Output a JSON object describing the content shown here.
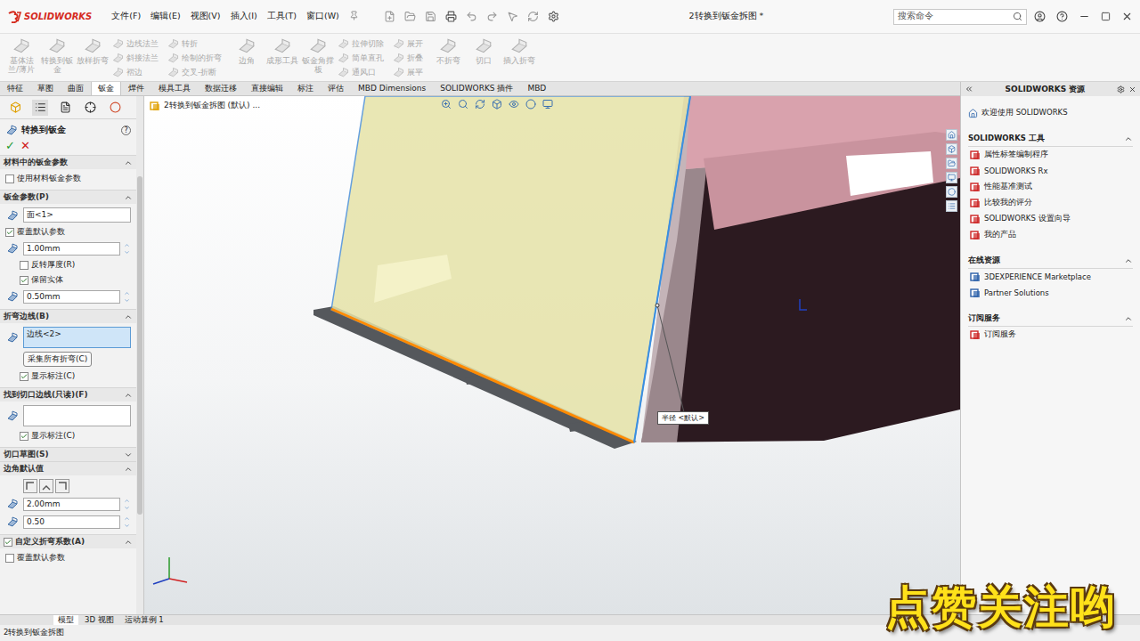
{
  "window": {
    "app": "SOLIDWORKS",
    "title": "2转换到钣金拆图 *"
  },
  "menus": [
    "文件(F)",
    "编辑(E)",
    "视图(V)",
    "插入(I)",
    "工具(T)",
    "窗口(W)"
  ],
  "search": {
    "placeholder": "搜索命令"
  },
  "ribbon": [
    {
      "kind": "large",
      "label": "基体法兰/薄片",
      "disabled": true
    },
    {
      "kind": "large",
      "label": "转换到钣金",
      "disabled": true
    },
    {
      "kind": "large",
      "label": "放样折弯",
      "disabled": true
    },
    {
      "kind": "stack",
      "items": [
        {
          "label": "边线法兰",
          "disabled": true
        },
        {
          "label": "斜接法兰",
          "disabled": true
        },
        {
          "label": "褶边",
          "disabled": true
        }
      ]
    },
    {
      "kind": "stack",
      "items": [
        {
          "label": "转折",
          "disabled": true
        },
        {
          "label": "绘制的折弯",
          "disabled": true
        },
        {
          "label": "交叉-折断",
          "disabled": true
        }
      ]
    },
    {
      "kind": "large",
      "label": "边角",
      "disabled": true
    },
    {
      "kind": "large",
      "label": "成形工具",
      "disabled": true
    },
    {
      "kind": "large",
      "label": "钣金角撑板",
      "disabled": true
    },
    {
      "kind": "stack",
      "items": [
        {
          "label": "拉伸切除",
          "disabled": true
        },
        {
          "label": "简单直孔",
          "disabled": true
        },
        {
          "label": "通风口",
          "disabled": true
        }
      ]
    },
    {
      "kind": "stack",
      "items": [
        {
          "label": "展开",
          "disabled": true
        },
        {
          "label": "折叠",
          "disabled": true
        },
        {
          "label": "展平",
          "disabled": true
        }
      ]
    },
    {
      "kind": "large",
      "label": "不折弯",
      "disabled": true
    },
    {
      "kind": "large",
      "label": "切口",
      "disabled": true
    },
    {
      "kind": "large",
      "label": "插入折弯",
      "disabled": true
    }
  ],
  "tabs": [
    {
      "label": "特征",
      "selected": false
    },
    {
      "label": "草图",
      "selected": false
    },
    {
      "label": "曲面",
      "selected": false
    },
    {
      "label": "钣金",
      "selected": true
    },
    {
      "label": "焊件",
      "selected": false
    },
    {
      "label": "模具工具",
      "selected": false
    },
    {
      "label": "数据迁移",
      "selected": false
    },
    {
      "label": "直接编辑",
      "selected": false
    },
    {
      "label": "标注",
      "selected": false
    },
    {
      "label": "评估",
      "selected": false
    },
    {
      "label": "MBD Dimensions",
      "selected": false
    },
    {
      "label": "SOLIDWORKS 插件",
      "selected": false
    },
    {
      "label": "MBD",
      "selected": false
    }
  ],
  "property_manager": {
    "title": "转换到钣金",
    "help": "?",
    "ok": "✓",
    "cancel": "✕",
    "sections": [
      {
        "title": "材料中的钣金参数",
        "expanded": true,
        "checkable": false,
        "checked": false,
        "rows": [
          {
            "kind": "checkbox",
            "label": "使用材料钣金参数",
            "checked": false,
            "nested": false
          }
        ]
      },
      {
        "title": "钣金参数(P)",
        "expanded": true,
        "checkable": false,
        "checked": false,
        "rows": [
          {
            "kind": "selection",
            "value": "面<1>",
            "active": false
          },
          {
            "kind": "checkbox",
            "label": "覆盖默认参数",
            "checked": true,
            "nested": false
          },
          {
            "kind": "number",
            "value": "1.00mm"
          },
          {
            "kind": "checkbox",
            "label": "反转厚度(R)",
            "checked": false,
            "nested": true
          },
          {
            "kind": "checkbox",
            "label": "保留实体",
            "checked": true,
            "nested": true
          },
          {
            "kind": "number",
            "value": "0.50mm"
          }
        ]
      },
      {
        "title": "折弯边线(B)",
        "expanded": true,
        "checkable": false,
        "checked": false,
        "rows": [
          {
            "kind": "list",
            "value": "边线<2>",
            "active": true
          },
          {
            "kind": "button",
            "label": "采集所有折弯(C)"
          },
          {
            "kind": "checkbox",
            "label": "显示标注(C)",
            "checked": true,
            "nested": true
          }
        ]
      },
      {
        "title": "找到切口边线(只读)(F)",
        "expanded": true,
        "checkable": false,
        "checked": false,
        "rows": [
          {
            "kind": "list",
            "value": "",
            "active": false
          },
          {
            "kind": "checkbox",
            "label": "显示标注(C)",
            "checked": true,
            "nested": true
          }
        ]
      },
      {
        "title": "切口草图(S)",
        "expanded": false,
        "checkable": false,
        "checked": false,
        "rows": []
      },
      {
        "title": "边角默认值",
        "expanded": true,
        "checkable": false,
        "checked": false,
        "rows": [
          {
            "kind": "icons",
            "items": [
              {
                "selected": false
              },
              {
                "selected": false
              },
              {
                "selected": false
              }
            ]
          },
          {
            "kind": "number",
            "value": "2.00mm"
          },
          {
            "kind": "number",
            "value": "0.50"
          }
        ]
      },
      {
        "title": "自定义折弯系数(A)",
        "expanded": true,
        "checkable": true,
        "checked": true,
        "rows": [
          {
            "kind": "checkbox",
            "label": "覆盖默认参数",
            "checked": false,
            "nested": false
          }
        ]
      }
    ]
  },
  "viewport": {
    "breadcrumb": "2转换到钣金拆图 (默认) ...",
    "callout": "半径 <默认>"
  },
  "resources": {
    "title": "SOLIDWORKS 资源",
    "welcome": "欢迎使用 SOLIDWORKS",
    "sections": [
      {
        "title": "SOLIDWORKS 工具",
        "expanded": true,
        "items": [
          "属性标签编制程序",
          "SOLIDWORKS Rx",
          "性能基准测试",
          "比较我的评分",
          "SOLIDWORKS 设置向导",
          "我的产品"
        ]
      },
      {
        "title": "在线资源",
        "expanded": true,
        "items": [
          "3DEXPERIENCE Marketplace",
          "Partner Solutions"
        ]
      },
      {
        "title": "订阅服务",
        "expanded": true,
        "items": [
          "订阅服务"
        ]
      }
    ]
  },
  "bottom_tabs": [
    {
      "label": "模型",
      "selected": true
    },
    {
      "label": "3D 视图",
      "selected": false
    },
    {
      "label": "运动算例 1",
      "selected": false
    }
  ],
  "status_bar": "2转换到钣金拆图",
  "watermark": "点赞关注哟"
}
